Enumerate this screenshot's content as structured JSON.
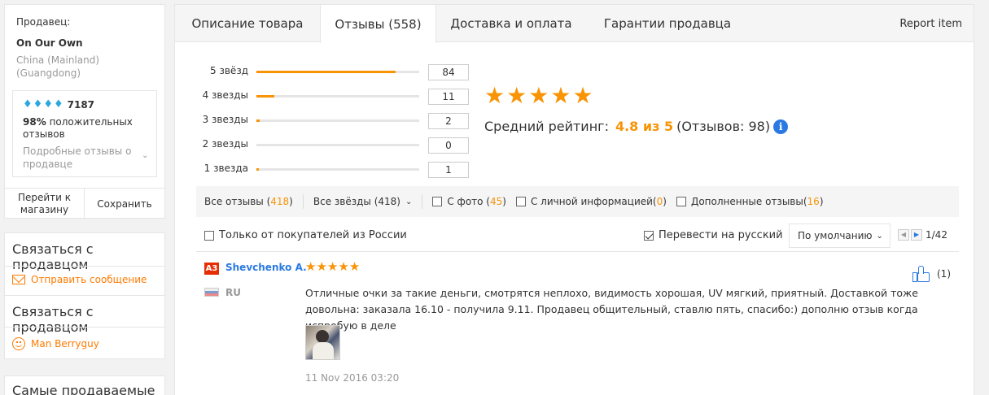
{
  "seller": {
    "label": "Продавец:",
    "name": "On Our Own",
    "location": "China (Mainland) (Guangdong)",
    "score": "7187",
    "positive_pct": "98%",
    "positive_text": "положительных отзывов",
    "detail_link": "Подробные отзывы о продавце",
    "go_store": "Перейти к магазину",
    "save": "Сохранить"
  },
  "contact": {
    "title1": "Связаться с продавцом",
    "send_message": "Отправить сообщение",
    "title2": "Связаться с продавцом",
    "person": "Man Berryguy"
  },
  "bestsellers": {
    "title": "Самые продаваемые"
  },
  "tabs": [
    {
      "label": "Описание товара"
    },
    {
      "label": "Отзывы (558)"
    },
    {
      "label": "Доставка и оплата"
    },
    {
      "label": "Гарантии продавца"
    }
  ],
  "report_item": "Report item",
  "distribution": [
    {
      "label": "5 звёзд",
      "count": "84",
      "fraction": 0.857
    },
    {
      "label": "4 звезды",
      "count": "11",
      "fraction": 0.112
    },
    {
      "label": "3 звезды",
      "count": "2",
      "fraction": 0.02
    },
    {
      "label": "2 звезды",
      "count": "0",
      "fraction": 0.0
    },
    {
      "label": "1 звезда",
      "count": "1",
      "fraction": 0.01
    }
  ],
  "average": {
    "label": "Средний рейтинг:",
    "value": "4.8 из 5",
    "reviews": "(Отзывов: 98)",
    "stars": 5
  },
  "filters": {
    "all_reviews": "Все отзывы (",
    "all_reviews_count": "418",
    "all_stars": "Все звёзды (418)",
    "with_photo": "С фото (",
    "with_photo_count": "45",
    "personal_info": "С личной информацией(",
    "personal_info_count": "0",
    "supplemented": "Дополненные отзывы(",
    "supplemented_count": "16",
    "close_paren": ")"
  },
  "options": {
    "russia_only": "Только от покупателей из России",
    "translate": "Перевести на русский",
    "translate_checked": true,
    "sort": "По умолчанию",
    "page": "1/42"
  },
  "review": {
    "badge": "A3",
    "name": "Shevchenko A.",
    "stars": 5,
    "country": "RU",
    "text": "Отличные очки за такие деньги, смотрятся неплохо, видимость хорошая, UV мягкий, приятный. Доставкой тоже довольна: заказала 16.10 - получила 9.11. Продавец общительный, ставлю пять, спасибо:) дополню отзыв когда испробую в деле",
    "date": "11 Nov 2016 03:20",
    "likes": "(1)"
  },
  "colors": {
    "accent": "#f89406",
    "link": "#2a7ae2",
    "badge": "#e62e04"
  }
}
